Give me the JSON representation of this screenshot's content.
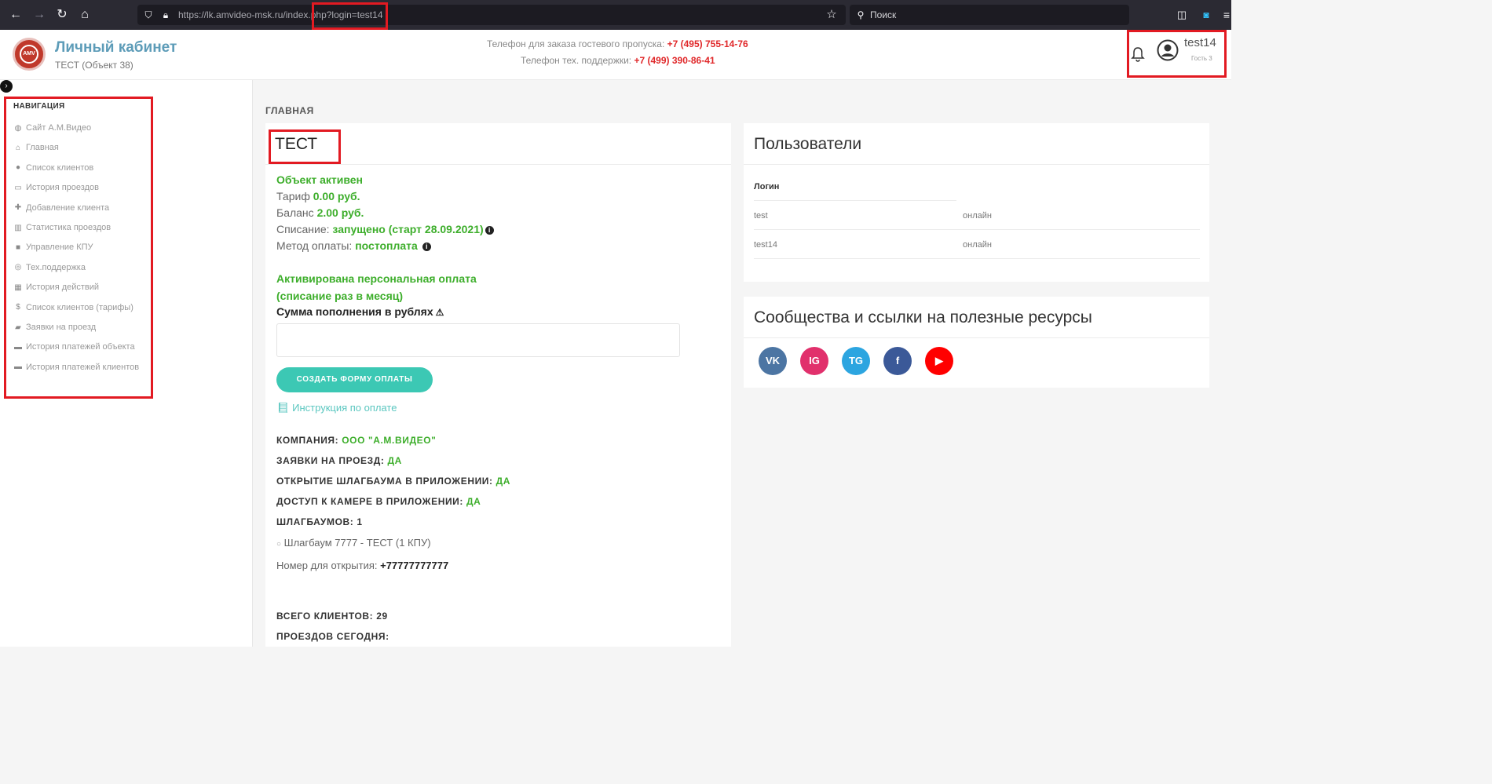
{
  "browser": {
    "url_main": "https://lk.amvideo-msk.ru/",
    "url_path": "index.php?login=test14",
    "search_placeholder": "Поиск"
  },
  "header": {
    "title": "Личный кабинет",
    "subtitle": "ТЕСТ (Объект 38)",
    "phone_guest_label": "Телефон для заказа гостевого пропуска:",
    "phone_guest": "+7 (495) 755-14-76",
    "phone_support_label": "Телефон тех. поддержки:",
    "phone_support": "+7 (499) 390-86-41",
    "user_name": "test14",
    "user_role": "Гость 3",
    "logo_text": "AMV"
  },
  "sidebar": {
    "title": "НАВИГАЦИЯ",
    "items": [
      {
        "label": "Сайт А.М.Видео",
        "icon": "globe-icon"
      },
      {
        "label": "Главная",
        "icon": "home-icon"
      },
      {
        "label": "Список клиентов",
        "icon": "user-icon"
      },
      {
        "label": "История проездов",
        "icon": "car-icon"
      },
      {
        "label": "Добавление клиента",
        "icon": "user-plus-icon"
      },
      {
        "label": "Статистика проездов",
        "icon": "bar-chart-icon"
      },
      {
        "label": "Управление КПУ",
        "icon": "video-icon"
      },
      {
        "label": "Тех.поддержка",
        "icon": "lifebuoy-icon"
      },
      {
        "label": "История действий",
        "icon": "calendar-icon"
      },
      {
        "label": "Список клиентов (тарифы)",
        "icon": "dollar-icon"
      },
      {
        "label": "Заявки на проезд",
        "icon": "book-icon"
      },
      {
        "label": "История платежей объекта",
        "icon": "credit-card-icon"
      },
      {
        "label": "История платежей клиентов",
        "icon": "credit-card-icon"
      }
    ]
  },
  "main": {
    "breadcrumb": "ГЛАВНАЯ",
    "object_title": "ТЕСТ",
    "status": "Объект активен",
    "tariff_label": "Тариф",
    "tariff_value": "0.00 руб.",
    "balance_label": "Баланс",
    "balance_value": "2.00 руб.",
    "writeoff_label": "Списание:",
    "writeoff_value": "запущено (старт 28.09.2021)",
    "payment_method_label": "Метод оплаты:",
    "payment_method_value": "постоплата",
    "personal_payment_line1": "Активирована персональная оплата",
    "personal_payment_line2": "(списание раз в месяц)",
    "amount_label": "Сумма пополнения в рублях",
    "amount_value": "",
    "pay_button": "СОЗДАТЬ ФОРМУ ОПЛАТЫ",
    "instruction_link": "Инструкция по оплате",
    "company_label": "КОМПАНИЯ:",
    "company_value": "ООО \"А.М.ВИДЕО\"",
    "requests_label": "ЗАЯВКИ НА ПРОЕЗД:",
    "requests_value": "ДА",
    "barrier_app_label": "ОТКРЫТИЕ ШЛАГБАУМА В ПРИЛОЖЕНИИ:",
    "barrier_app_value": "ДА",
    "camera_label": "ДОСТУП К КАМЕРЕ В ПРИЛОЖЕНИИ:",
    "camera_value": "ДА",
    "barriers_label": "ШЛАГБАУМОВ: 1",
    "barrier_item": "Шлагбаум 7777 - ТЕСТ (1 КПУ)",
    "open_number_label": "Номер для открытия:",
    "open_number_value": "+77777777777",
    "total_clients": "ВСЕГО КЛИЕНТОВ: 29",
    "passes_today": "ПРОЕЗДОВ СЕГОДНЯ:"
  },
  "users_card": {
    "title": "Пользователи",
    "column_login": "Логин",
    "rows": [
      {
        "login": "test",
        "status": "онлайн"
      },
      {
        "login": "test14",
        "status": "онлайн"
      }
    ]
  },
  "links_card": {
    "title": "Сообщества и ссылки на полезные ресурсы",
    "socials": [
      {
        "name": "vk-icon",
        "label": "VK",
        "color": "#4c75a3"
      },
      {
        "name": "instagram-icon",
        "label": "IG",
        "color": "#e1306c"
      },
      {
        "name": "telegram-icon",
        "label": "TG",
        "color": "#2ca5e0"
      },
      {
        "name": "facebook-icon",
        "label": "f",
        "color": "#3b5998"
      },
      {
        "name": "youtube-icon",
        "label": "▶",
        "color": "#ff0000"
      }
    ]
  },
  "colors": {
    "accent_green": "#3dae2b",
    "accent_teal": "#3cc8b4",
    "phone_red": "#e0282a",
    "highlight_red": "#e21a22"
  }
}
